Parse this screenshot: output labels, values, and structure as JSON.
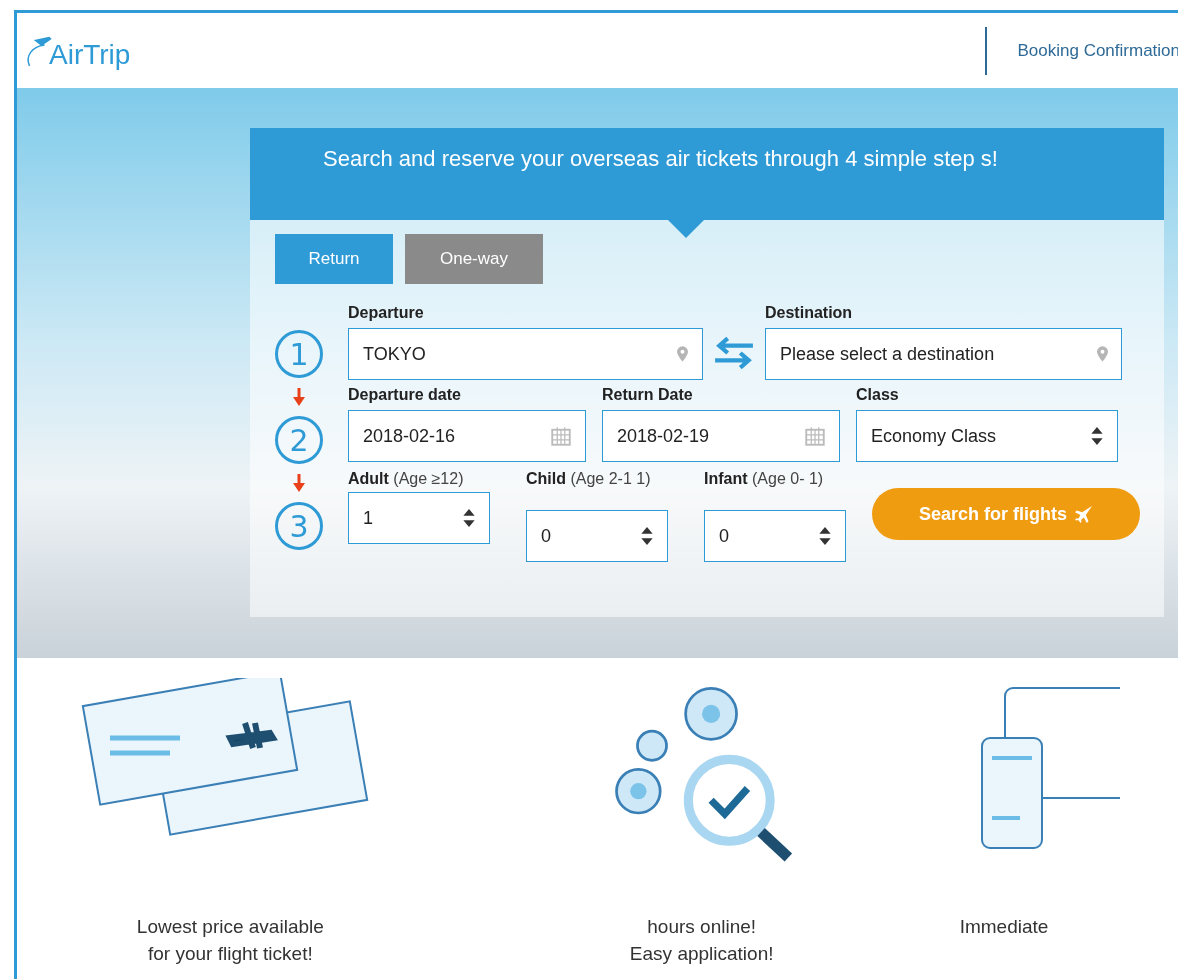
{
  "header": {
    "logo": "AirTrip",
    "nav_link": "Booking Confirmation"
  },
  "search_card": {
    "heading": "Search and reserve your overseas air tickets through 4 simple step s!",
    "trip_tabs": [
      {
        "label": "Return",
        "selected": true
      },
      {
        "label": "One-way",
        "selected": false
      }
    ],
    "steps": [
      "1",
      "2",
      "3"
    ],
    "departure": {
      "label": "Departure",
      "value": "TOKYO"
    },
    "destination": {
      "label": "Destination",
      "placeholder": "Please select a destination"
    },
    "departure_date": {
      "label": "Departure date",
      "value": "2018-02-16"
    },
    "return_date": {
      "label": "Return Date",
      "value": "2018-02-19"
    },
    "class": {
      "label": "Class",
      "value": "Economy Class"
    },
    "passengers": [
      {
        "label": "Adult",
        "note": "(Age ≥12)",
        "value": "1"
      },
      {
        "label": "Child",
        "note": "(Age 2-1 1)",
        "value": "0"
      },
      {
        "label": "Infant",
        "note": "(Age 0- 1)",
        "value": "0"
      }
    ],
    "search_button": "Search for flights"
  },
  "features": [
    {
      "kind": "tickets",
      "lines": [
        "Lowest price available",
        "for your flight ticket!"
      ]
    },
    {
      "kind": "gears",
      "lines": [
        "hours online!",
        "Easy application!"
      ]
    },
    {
      "kind": "devices",
      "lines": [
        "Immediate"
      ]
    }
  ]
}
